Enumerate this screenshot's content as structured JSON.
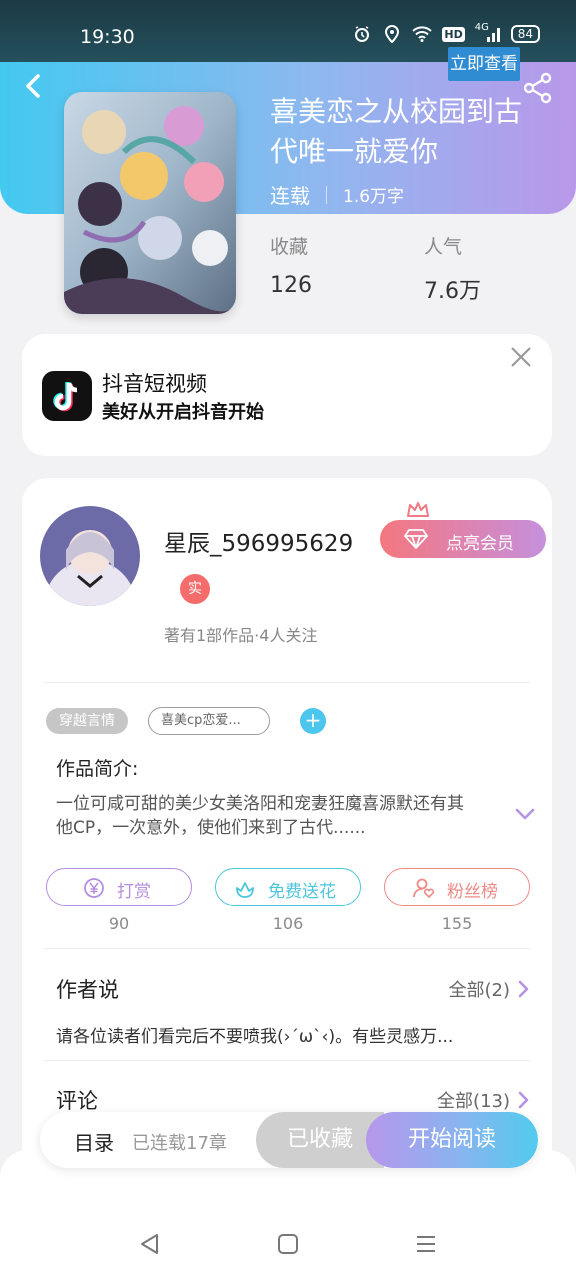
{
  "status_bar": {
    "time": "19:30",
    "hd": "HD",
    "network": "4G",
    "battery": "84",
    "icons": [
      "alarm-icon",
      "location-icon",
      "wifi-icon",
      "hd-icon",
      "signal-icon",
      "battery-icon"
    ]
  },
  "book": {
    "title": "喜美恋之从校园到古代唯一就爱你",
    "status": "连载",
    "words": "1.6万字",
    "stats": [
      {
        "label": "收藏",
        "value": "126"
      },
      {
        "label": "人气",
        "value": "7.6万"
      }
    ]
  },
  "ad": {
    "title": "抖音短视频",
    "description": "美好从开启抖音开始",
    "button": "立即查看"
  },
  "author": {
    "name": "星辰_596995629",
    "badge": "实",
    "stats": "著有1部作品·4人关注",
    "vip_button": "点亮会员"
  },
  "tags": {
    "genre": "穿越言情",
    "custom": "喜美cp恋爱...",
    "add": "+"
  },
  "intro": {
    "title": "作品简介:",
    "text": "一位可咸可甜的美少女美洛阳和宠妻狂魔喜源默还有其他CP，一次意外，使他们来到了古代......"
  },
  "actions": [
    {
      "label": "打赏",
      "count": "90",
      "color": "#b58ee0"
    },
    {
      "label": "免费送花",
      "count": "106",
      "color": "#4cc6dd"
    },
    {
      "label": "粉丝榜",
      "count": "155",
      "color": "#ee8a86"
    }
  ],
  "author_says": {
    "title": "作者说",
    "more": "全部(2)",
    "note": "请各位读者们看完后不要喷我(›´ω`‹)。有些灵感万..."
  },
  "comments": {
    "title": "评论",
    "more": "全部(13)"
  },
  "read_bar": {
    "toc": "目录",
    "chapters": "已连载17章",
    "collected": "已收藏",
    "start": "开始阅读"
  },
  "colors": {
    "header_start": "#43c9f0",
    "header_end": "#b998ea",
    "accent_blue": "#4cc6ec",
    "vip_pink": "#f4777e"
  }
}
